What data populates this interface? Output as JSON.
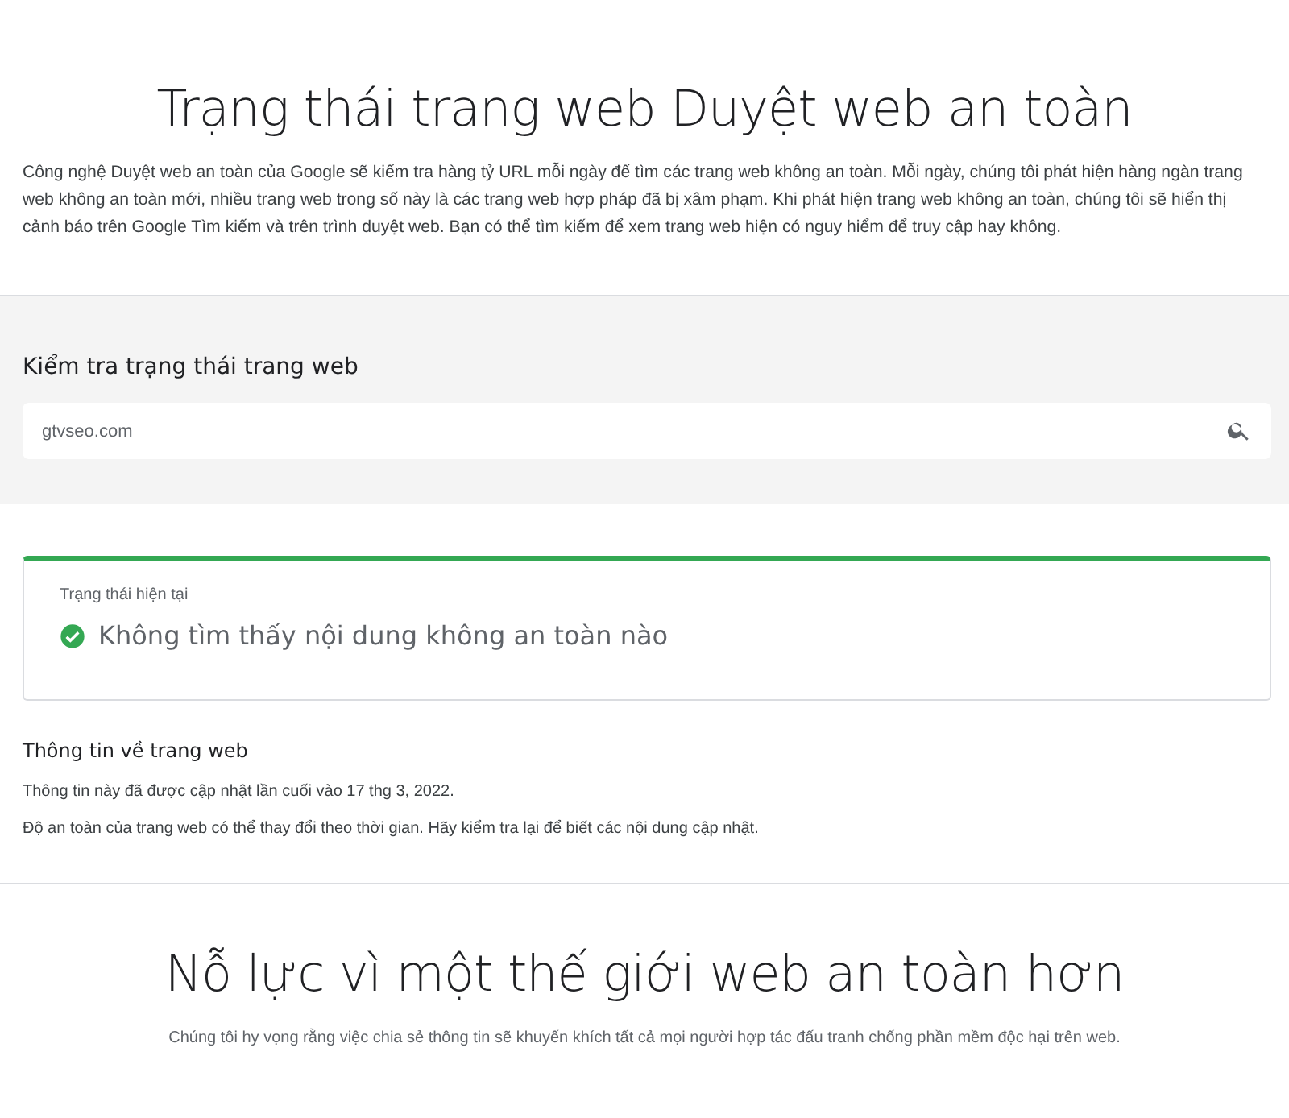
{
  "header": {
    "title": "Trạng thái trang web Duyệt web an toàn",
    "intro": "Công nghệ Duyệt web an toàn của Google sẽ kiểm tra hàng tỷ URL mỗi ngày để tìm các trang web không an toàn. Mỗi ngày, chúng tôi phát hiện hàng ngàn trang web không an toàn mới, nhiều trang web trong số này là các trang web hợp pháp đã bị xâm phạm. Khi phát hiện trang web không an toàn, chúng tôi sẽ hiển thị cảnh báo trên Google Tìm kiếm và trên trình duyệt web. Bạn có thể tìm kiếm để xem trang web hiện có nguy hiểm để truy cập hay không."
  },
  "check": {
    "heading": "Kiểm tra trạng thái trang web",
    "search": {
      "value": "gtvseo.com"
    }
  },
  "status": {
    "label": "Trạng thái hiện tại",
    "message": "Không tìm thấy nội dung không an toàn nào",
    "safe": true
  },
  "site_info": {
    "heading": "Thông tin về trang web",
    "lines": [
      "Thông tin này đã được cập nhật lần cuối vào 17 thg 3, 2022.",
      "Độ an toàn của trang web có thể thay đổi theo thời gian. Hãy kiểm tra lại để biết các nội dung cập nhật."
    ]
  },
  "footer": {
    "title": "Nỗ lực vì một thế giới web an toàn hơn",
    "text": "Chúng tôi hy vọng rằng việc chia sẻ thông tin sẽ khuyến khích tất cả mọi người hợp tác đấu tranh chống phần mềm độc hại trên web."
  }
}
